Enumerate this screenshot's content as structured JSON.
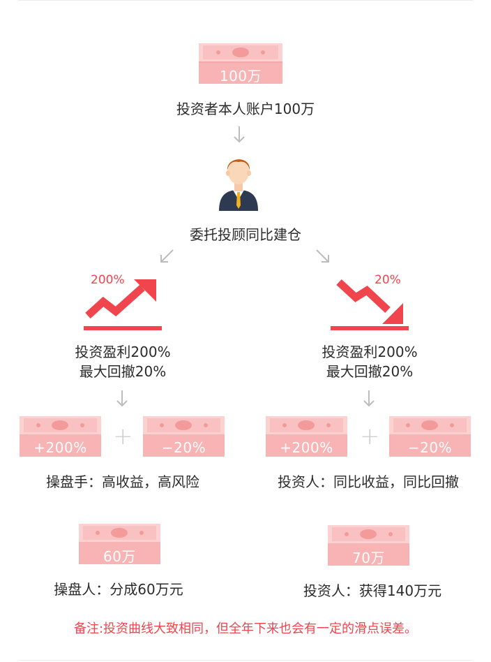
{
  "top": {
    "money_label": "100万",
    "caption": "投资者本人账户100万"
  },
  "advisor": {
    "caption": "委托投顾同比建仓"
  },
  "left": {
    "trend_pct": "200%",
    "line1": "投资盈利200%",
    "line2": "最大回撤20%",
    "bill_gain": "+200%",
    "bill_loss": "−20%",
    "caption": "操盘手：高收益，高风险",
    "result_money": "60万",
    "result_caption": "操盘人：分成60万元"
  },
  "right": {
    "trend_pct": "20%",
    "line1": "投资盈利200%",
    "line2": "最大回撤20%",
    "bill_gain": "+200%",
    "bill_loss": "−20%",
    "caption": "投资人：同比收益，同比回撤",
    "result_money": "70万",
    "result_caption": "投资人：获得140万元"
  },
  "plus_sign": "+",
  "note": "备注:投资曲线大致相同，但全年下来也会有一定的滑点误差。",
  "colors": {
    "bill_light": "#fbd1d1",
    "bill_mid": "#f8b4b4",
    "bill_dark": "#f39a9a",
    "accent_red": "#f0454d",
    "arrow_gray": "#bcbcbc"
  },
  "icons": {
    "money": "money-stack-icon",
    "person": "businessman-icon",
    "arrow": "arrow-down-icon",
    "up_trend": "trend-up-arrow-icon",
    "down_trend": "trend-down-arrow-icon"
  }
}
